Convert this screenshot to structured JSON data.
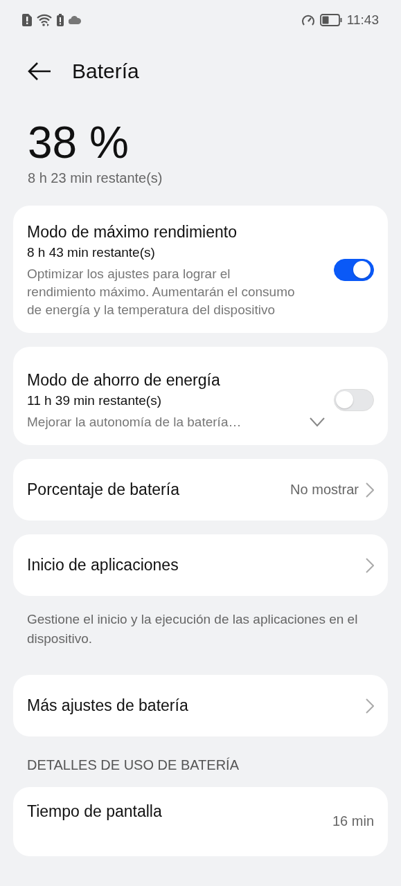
{
  "status_bar": {
    "time": "11:43"
  },
  "header": {
    "title": "Batería"
  },
  "battery": {
    "percent": "38 %",
    "remaining": "8 h 23 min restante(s)"
  },
  "items": [
    {
      "kind": "toggle",
      "title": "Modo de máximo rendimiento",
      "subtitle": "8 h 43 min restante(s)",
      "description": "Optimizar los ajustes para lograr el rendimiento máximo. Aumentarán el consumo de energía y la temperatura del dispositivo",
      "on": true
    },
    {
      "kind": "toggle",
      "title": "Modo de ahorro de energía",
      "subtitle": "11 h 39 min restante(s)",
      "description": "Mejorar la autonomía de la batería…",
      "on": false,
      "expanded": false
    },
    {
      "kind": "link",
      "title": "Porcentaje de batería",
      "value": "No mostrar"
    },
    {
      "kind": "link",
      "title": "Inicio de aplicaciones"
    },
    {
      "kind": "note",
      "text": "Gestione el inicio y la ejecución de las aplicaciones en el dispositivo."
    },
    {
      "kind": "link",
      "title": "Más ajustes de batería"
    },
    {
      "kind": "section",
      "text": "DETALLES DE USO DE BATERÍA"
    },
    {
      "kind": "usage",
      "title": "Tiempo de pantalla",
      "value": "16 min"
    }
  ]
}
